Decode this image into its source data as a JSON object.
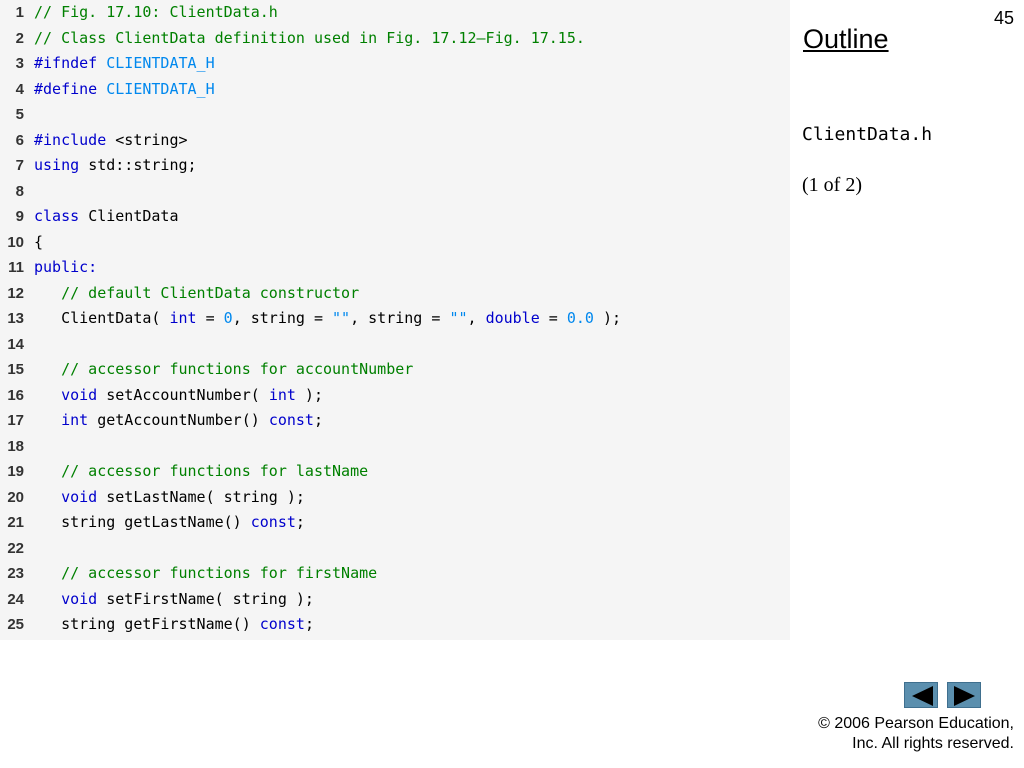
{
  "slide": {
    "number": "45",
    "outline_title": "Outline",
    "file_name": "ClientData.h",
    "page_count": "(1 of 2)",
    "copyright_line1": "© 2006 Pearson Education,",
    "copyright_line2": "Inc.  All rights reserved."
  },
  "nav": {
    "prev_icon": "left-triangle-icon",
    "next_icon": "right-triangle-icon"
  },
  "colors": {
    "keyword": "#0000cc",
    "comment": "#008000",
    "literal": "#0088ee",
    "code_background": "#f5f5f5",
    "nav_button": "#5b8fae"
  },
  "code": [
    {
      "num": "1",
      "tokens": [
        {
          "t": "// Fig. 17.10: ClientData.h",
          "c": "c"
        }
      ]
    },
    {
      "num": "2",
      "tokens": [
        {
          "t": "// Class ClientData definition used in Fig. 17.12–Fig. 17.15.",
          "c": "c"
        }
      ]
    },
    {
      "num": "3",
      "tokens": [
        {
          "t": "#ifndef ",
          "c": "k"
        },
        {
          "t": "CLIENTDATA_H",
          "c": "l"
        }
      ]
    },
    {
      "num": "4",
      "tokens": [
        {
          "t": "#define ",
          "c": "k"
        },
        {
          "t": "CLIENTDATA_H",
          "c": "l"
        }
      ]
    },
    {
      "num": "5",
      "tokens": []
    },
    {
      "num": "6",
      "tokens": [
        {
          "t": "#include ",
          "c": "k"
        },
        {
          "t": "<string>",
          "c": "p"
        }
      ]
    },
    {
      "num": "7",
      "tokens": [
        {
          "t": "using ",
          "c": "k"
        },
        {
          "t": "std::string;",
          "c": "p"
        }
      ]
    },
    {
      "num": "8",
      "tokens": []
    },
    {
      "num": "9",
      "tokens": [
        {
          "t": "class ",
          "c": "k"
        },
        {
          "t": "ClientData",
          "c": "p"
        }
      ]
    },
    {
      "num": "10",
      "tokens": [
        {
          "t": "{",
          "c": "p"
        }
      ]
    },
    {
      "num": "11",
      "tokens": [
        {
          "t": "public:",
          "c": "k"
        }
      ]
    },
    {
      "num": "12",
      "tokens": [
        {
          "t": "   // default ClientData constructor",
          "c": "c"
        }
      ]
    },
    {
      "num": "13",
      "tokens": [
        {
          "t": "   ClientData( ",
          "c": "p"
        },
        {
          "t": "int",
          "c": "k"
        },
        {
          "t": " = ",
          "c": "p"
        },
        {
          "t": "0",
          "c": "l"
        },
        {
          "t": ", string = ",
          "c": "p"
        },
        {
          "t": "\"\"",
          "c": "l"
        },
        {
          "t": ", string = ",
          "c": "p"
        },
        {
          "t": "\"\"",
          "c": "l"
        },
        {
          "t": ", ",
          "c": "p"
        },
        {
          "t": "double",
          "c": "k"
        },
        {
          "t": " = ",
          "c": "p"
        },
        {
          "t": "0.0",
          "c": "l"
        },
        {
          "t": " );",
          "c": "p"
        }
      ]
    },
    {
      "num": "14",
      "tokens": []
    },
    {
      "num": "15",
      "tokens": [
        {
          "t": "   // accessor functions for accountNumber",
          "c": "c"
        }
      ]
    },
    {
      "num": "16",
      "tokens": [
        {
          "t": "   ",
          "c": "p"
        },
        {
          "t": "void",
          "c": "k"
        },
        {
          "t": " setAccountNumber( ",
          "c": "p"
        },
        {
          "t": "int",
          "c": "k"
        },
        {
          "t": " );",
          "c": "p"
        }
      ]
    },
    {
      "num": "17",
      "tokens": [
        {
          "t": "   ",
          "c": "p"
        },
        {
          "t": "int",
          "c": "k"
        },
        {
          "t": " getAccountNumber() ",
          "c": "p"
        },
        {
          "t": "const",
          "c": "k"
        },
        {
          "t": ";",
          "c": "p"
        }
      ]
    },
    {
      "num": "18",
      "tokens": []
    },
    {
      "num": "19",
      "tokens": [
        {
          "t": "   // accessor functions for lastName",
          "c": "c"
        }
      ]
    },
    {
      "num": "20",
      "tokens": [
        {
          "t": "   ",
          "c": "p"
        },
        {
          "t": "void",
          "c": "k"
        },
        {
          "t": " setLastName( string );",
          "c": "p"
        }
      ]
    },
    {
      "num": "21",
      "tokens": [
        {
          "t": "   string getLastName() ",
          "c": "p"
        },
        {
          "t": "const",
          "c": "k"
        },
        {
          "t": ";",
          "c": "p"
        }
      ]
    },
    {
      "num": "22",
      "tokens": []
    },
    {
      "num": "23",
      "tokens": [
        {
          "t": "   // accessor functions for firstName",
          "c": "c"
        }
      ]
    },
    {
      "num": "24",
      "tokens": [
        {
          "t": "   ",
          "c": "p"
        },
        {
          "t": "void",
          "c": "k"
        },
        {
          "t": " setFirstName( string );",
          "c": "p"
        }
      ]
    },
    {
      "num": "25",
      "tokens": [
        {
          "t": "   string getFirstName() ",
          "c": "p"
        },
        {
          "t": "const",
          "c": "k"
        },
        {
          "t": ";",
          "c": "p"
        }
      ]
    }
  ]
}
